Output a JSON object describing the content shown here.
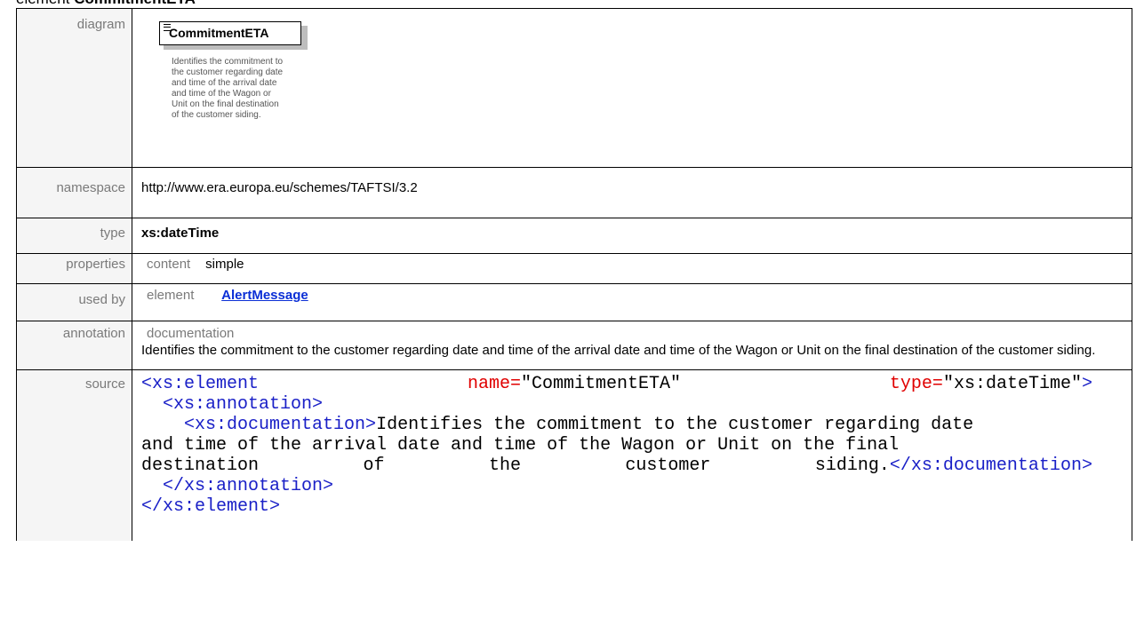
{
  "heading": {
    "prefix": "element",
    "name": "CommitmentETA"
  },
  "rows": {
    "diagram": {
      "label": "diagram"
    },
    "namespace": {
      "label": "namespace",
      "value": "http://www.era.europa.eu/schemes/TAFTSI/3.2"
    },
    "type": {
      "label": "type",
      "value": "xs:dateTime"
    },
    "properties": {
      "label": "properties",
      "key": "content",
      "value": "simple"
    },
    "used_by": {
      "label": "used by",
      "key": "element",
      "value": "AlertMessage"
    },
    "annotation": {
      "label": "annotation",
      "key": "documentation",
      "value": "Identifies the commitment to the customer regarding date and time of the arrival date and time of the Wagon or Unit on the final destination of the customer siding."
    },
    "source": {
      "label": "source"
    }
  },
  "diagram": {
    "element_name": "CommitmentETA",
    "description_lines": [
      "Identifies the commitment to",
      "the customer regarding date",
      "and time of the arrival date",
      "and time of the Wagon or",
      "Unit on the final destination",
      "of the customer siding."
    ]
  },
  "source_code": {
    "l1_tag": "<xs:element",
    "l1_attr1": "name=",
    "l1_val1": "\"CommitmentETA\"",
    "l1_attr2": "type=",
    "l1_val2": "\"xs:dateTime\"",
    "l1_close": ">",
    "l2": "<xs:annotation>",
    "l3_tag": "<xs:documentation>",
    "l3_text": "Identifies the commitment to the customer regarding date",
    "l4": "and time of the arrival date and time of the Wagon or Unit on the final",
    "l5_words": [
      "destination",
      "of",
      "the",
      "customer"
    ],
    "l5_last": "siding.",
    "l5_end": "</xs:documentation>",
    "l6": "</xs:annotation>",
    "l7": "</xs:element>"
  },
  "colors": {
    "tag": "#1a20c7",
    "attribute": "#e00000",
    "link": "#0b2fd6",
    "label": "#7a7a7a"
  }
}
